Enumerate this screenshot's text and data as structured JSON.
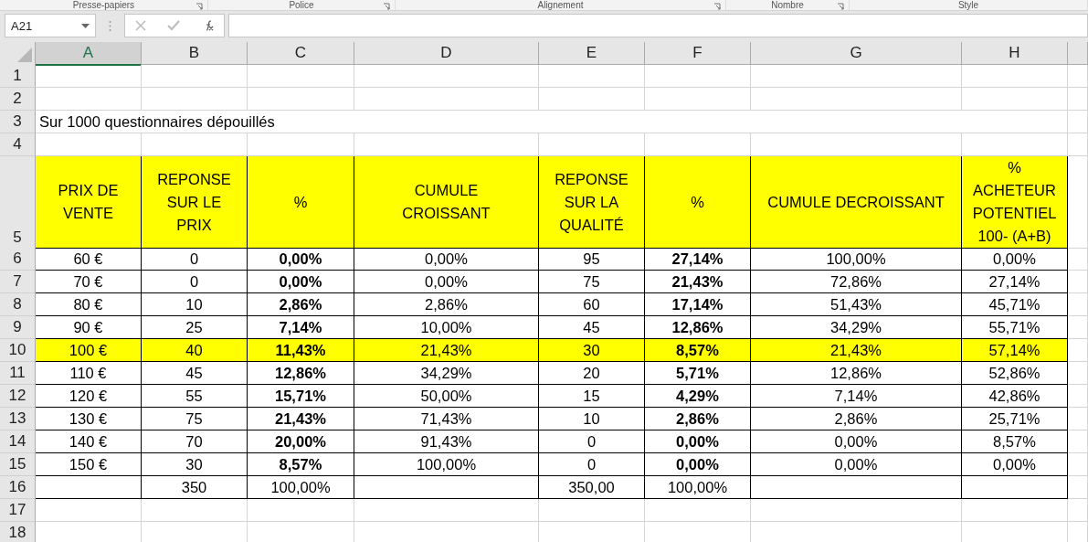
{
  "ribbon_groups": [
    "Presse-papiers",
    "Police",
    "Alignement",
    "Nombre",
    "Style"
  ],
  "name_box": {
    "value": "A21"
  },
  "columns": [
    {
      "label": "A",
      "selected": true,
      "bold": false
    },
    {
      "label": "B",
      "selected": false,
      "bold": false
    },
    {
      "label": "C",
      "selected": false,
      "bold": true
    },
    {
      "label": "D",
      "selected": false,
      "bold": false
    },
    {
      "label": "E",
      "selected": false,
      "bold": false
    },
    {
      "label": "F",
      "selected": false,
      "bold": true
    },
    {
      "label": "G",
      "selected": false,
      "bold": false
    },
    {
      "label": "H",
      "selected": false,
      "bold": false
    }
  ],
  "rows": [
    {
      "number": "1",
      "kind": "blank",
      "highlighted": false,
      "cells": []
    },
    {
      "number": "2",
      "kind": "blank",
      "highlighted": false,
      "cells": []
    },
    {
      "number": "3",
      "kind": "text",
      "highlighted": false,
      "cells": [
        "Sur 1000 questionnaires dépouillés"
      ]
    },
    {
      "number": "4",
      "kind": "blank",
      "highlighted": false,
      "cells": []
    },
    {
      "number": "5",
      "kind": "header",
      "highlighted": true,
      "cells": [
        "PRIX DE\nVENTE",
        "REPONSE\nSUR LE\nPRIX",
        "%",
        "CUMULE\nCROISSANT",
        "REPONSE\nSUR LA\nQUALITÉ",
        "%",
        "CUMULE DECROISSANT",
        "%\nACHETEUR\nPOTENTIEL\n100- (A+B)"
      ]
    },
    {
      "number": "6",
      "kind": "data",
      "highlighted": false,
      "cells": [
        "60 €",
        "0",
        "0,00%",
        "0,00%",
        "95",
        "27,14%",
        "100,00%",
        "0,00%"
      ]
    },
    {
      "number": "7",
      "kind": "data",
      "highlighted": false,
      "cells": [
        "70 €",
        "0",
        "0,00%",
        "0,00%",
        "75",
        "21,43%",
        "72,86%",
        "27,14%"
      ]
    },
    {
      "number": "8",
      "kind": "data",
      "highlighted": false,
      "cells": [
        "80 €",
        "10",
        "2,86%",
        "2,86%",
        "60",
        "17,14%",
        "51,43%",
        "45,71%"
      ]
    },
    {
      "number": "9",
      "kind": "data",
      "highlighted": false,
      "cells": [
        "90 €",
        "25",
        "7,14%",
        "10,00%",
        "45",
        "12,86%",
        "34,29%",
        "55,71%"
      ]
    },
    {
      "number": "10",
      "kind": "data",
      "highlighted": true,
      "cells": [
        "100 €",
        "40",
        "11,43%",
        "21,43%",
        "30",
        "8,57%",
        "21,43%",
        "57,14%"
      ]
    },
    {
      "number": "11",
      "kind": "data",
      "highlighted": false,
      "cells": [
        "110 €",
        "45",
        "12,86%",
        "34,29%",
        "20",
        "5,71%",
        "12,86%",
        "52,86%"
      ]
    },
    {
      "number": "12",
      "kind": "data",
      "highlighted": false,
      "cells": [
        "120 €",
        "55",
        "15,71%",
        "50,00%",
        "15",
        "4,29%",
        "7,14%",
        "42,86%"
      ]
    },
    {
      "number": "13",
      "kind": "data",
      "highlighted": false,
      "cells": [
        "130 €",
        "75",
        "21,43%",
        "71,43%",
        "10",
        "2,86%",
        "2,86%",
        "25,71%"
      ]
    },
    {
      "number": "14",
      "kind": "data",
      "highlighted": false,
      "cells": [
        "140 €",
        "70",
        "20,00%",
        "91,43%",
        "0",
        "0,00%",
        "0,00%",
        "8,57%"
      ]
    },
    {
      "number": "15",
      "kind": "data",
      "highlighted": false,
      "cells": [
        "150 €",
        "30",
        "8,57%",
        "100,00%",
        "0",
        "0,00%",
        "0,00%",
        "0,00%"
      ]
    },
    {
      "number": "16",
      "kind": "total",
      "highlighted": false,
      "cells": [
        null,
        "350",
        "100,00%",
        null,
        "350,00",
        "100,00%",
        null,
        null
      ]
    },
    {
      "number": "17",
      "kind": "blank",
      "highlighted": false,
      "cells": []
    },
    {
      "number": "18",
      "kind": "blank",
      "highlighted": false,
      "cells": []
    }
  ]
}
